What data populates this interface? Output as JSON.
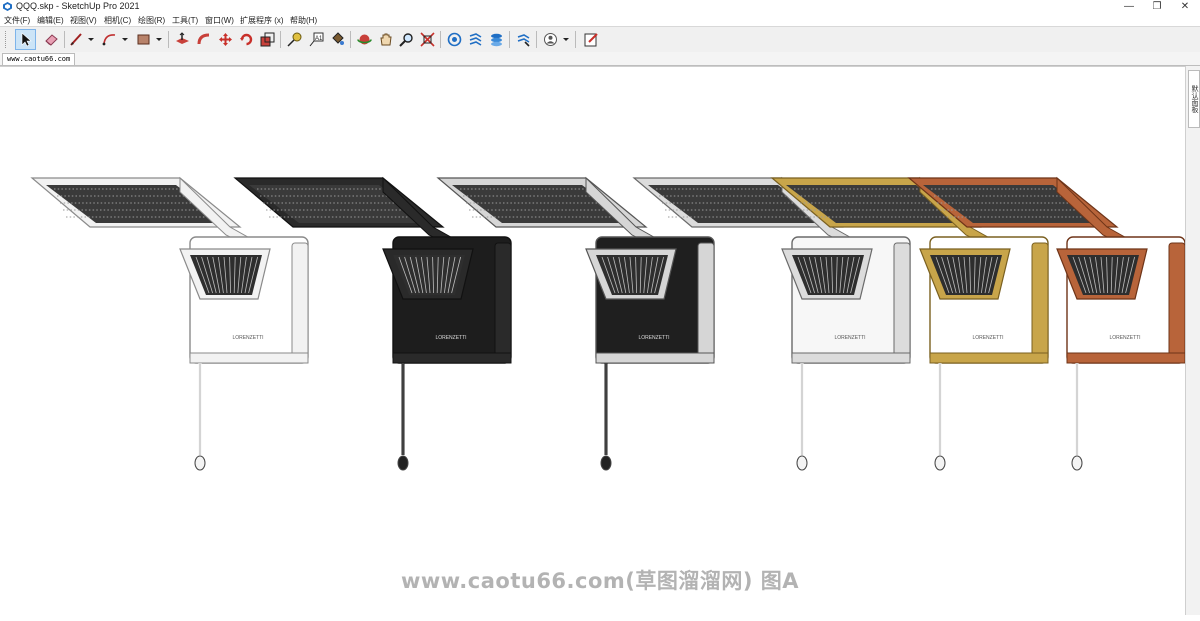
{
  "window": {
    "title": "QQQ.skp - SketchUp Pro 2021",
    "controls": [
      "—",
      "❐",
      "✕"
    ]
  },
  "menu": [
    "文件(F)",
    "编辑(E)",
    "视图(V)",
    "相机(C)",
    "绘图(R)",
    "工具(T)",
    "窗口(W)",
    "扩展程序 (x)",
    "帮助(H)"
  ],
  "toolbar": {
    "tools": [
      {
        "name": "select-tool-icon",
        "active": true
      },
      {
        "name": "eraser-tool-icon"
      },
      {
        "name": "line-tool-icon"
      },
      {
        "name": "dropdown-arrow-icon"
      },
      {
        "name": "arc-tool-icon"
      },
      {
        "name": "dropdown-arrow-icon"
      },
      {
        "name": "rectangle-tool-icon"
      },
      {
        "name": "dropdown-arrow-icon"
      },
      {
        "name": "push-pull-tool-icon"
      },
      {
        "name": "follow-me-tool-icon"
      },
      {
        "name": "move-tool-icon"
      },
      {
        "name": "rotate-tool-icon"
      },
      {
        "name": "scale-tool-icon"
      },
      {
        "name": "tape-measure-tool-icon"
      },
      {
        "name": "text-tool-icon"
      },
      {
        "name": "paint-bucket-tool-icon"
      },
      {
        "name": "orbit-tool-icon"
      },
      {
        "name": "pan-tool-icon"
      },
      {
        "name": "zoom-tool-icon"
      },
      {
        "name": "zoom-extents-tool-icon"
      },
      {
        "name": "3d-warehouse-icon"
      },
      {
        "name": "extension-warehouse-icon"
      },
      {
        "name": "layout-icon"
      },
      {
        "name": "extension-manager-icon"
      },
      {
        "name": "account-icon"
      },
      {
        "name": "dropdown-arrow-icon"
      },
      {
        "name": "send-to-layout-icon"
      }
    ]
  },
  "scenes": {
    "tab_label": "www.caotu66.com"
  },
  "tray": {
    "tab_label": "默认面板"
  },
  "viewport": {
    "watermark": "www.caotu66.com(草图溜溜网) 图A",
    "models": [
      {
        "name": "shower-white",
        "finish": "#f2f2f2",
        "edge": "#8a8a8a",
        "body": "#ffffff",
        "brand": "LORENZETTI",
        "handle": "#f4f4f4"
      },
      {
        "name": "shower-black",
        "finish": "#2a2a2a",
        "edge": "#111111",
        "body": "#1d1d1d",
        "brand": "LORENZETTI",
        "handle": "#222222"
      },
      {
        "name": "shower-black-chrome",
        "finish": "#d6d6d6",
        "edge": "#555555",
        "body": "#1f1f1f",
        "brand": "LORENZETTI",
        "handle": "#222222"
      },
      {
        "name": "shower-chrome",
        "finish": "#dcdcdc",
        "edge": "#6a6a6a",
        "body": "#f7f7f7",
        "brand": "LORENZETTI",
        "handle": "#f4f4f4"
      },
      {
        "name": "shower-gold",
        "finish": "#c8a54a",
        "edge": "#7a6020",
        "body": "#ffffff",
        "brand": "LORENZETTI",
        "handle": "#f4f4f4"
      },
      {
        "name": "shower-copper",
        "finish": "#b8643a",
        "edge": "#6e3418",
        "body": "#ffffff",
        "brand": "LORENZETTI",
        "handle": "#f4f4f4"
      }
    ]
  }
}
